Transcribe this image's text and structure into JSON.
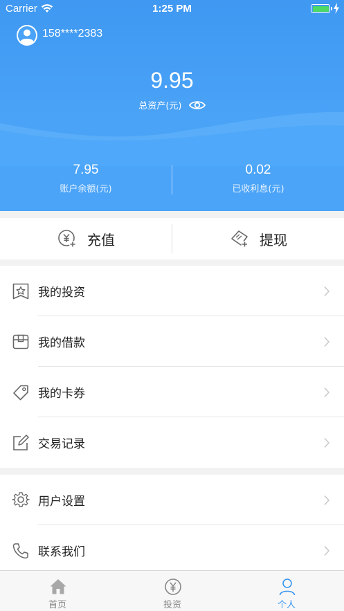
{
  "status_bar": {
    "carrier": "Carrier",
    "time": "1:25 PM"
  },
  "profile": {
    "phone": "158****2383"
  },
  "assets": {
    "total_value": "9.95",
    "total_label": "总资产(元)",
    "balance_value": "7.95",
    "balance_label": "账户余额(元)",
    "interest_value": "0.02",
    "interest_label": "已收利息(元)"
  },
  "actions": {
    "recharge": "充值",
    "withdraw": "提现"
  },
  "menu_group1": [
    {
      "label": "我的投资",
      "icon": "star-icon"
    },
    {
      "label": "我的借款",
      "icon": "box-icon"
    },
    {
      "label": "我的卡券",
      "icon": "tag-icon"
    },
    {
      "label": "交易记录",
      "icon": "edit-icon"
    }
  ],
  "menu_group2": [
    {
      "label": "用户设置",
      "icon": "gear-icon"
    },
    {
      "label": "联系我们",
      "icon": "phone-icon"
    }
  ],
  "tabbar": {
    "home": "首页",
    "invest": "投资",
    "me": "个人"
  },
  "colors": {
    "primary": "#4aa3f7",
    "active_tab": "#3a95ef",
    "icon_gray": "#666666"
  }
}
